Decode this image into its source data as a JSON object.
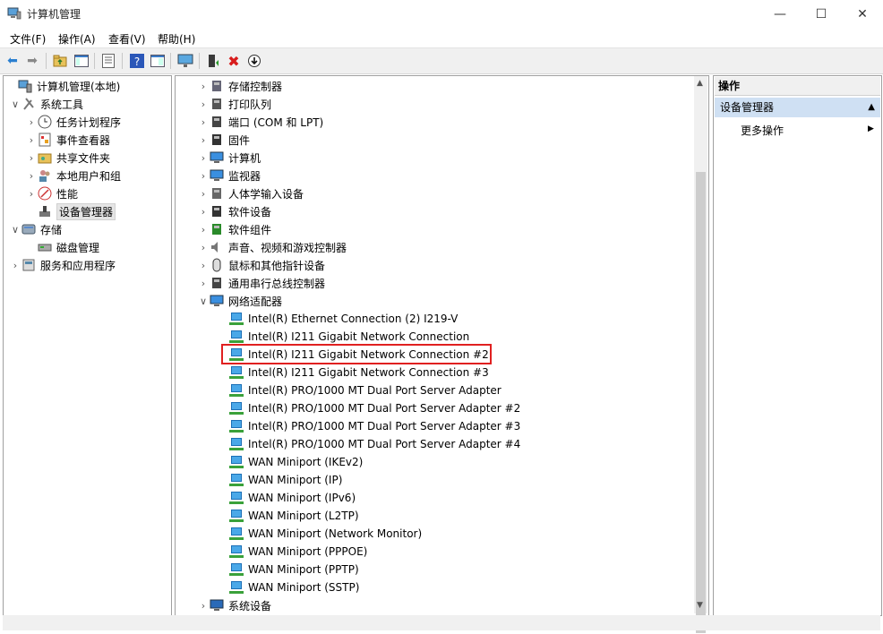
{
  "window": {
    "title": "计算机管理",
    "minimize": "—",
    "maximize": "☐",
    "close": "✕"
  },
  "menu": [
    "文件(F)",
    "操作(A)",
    "查看(V)",
    "帮助(H)"
  ],
  "toolbar_icons": [
    "back-arrow-icon",
    "forward-arrow-icon",
    "folder-up-icon",
    "console-tree-icon",
    "properties-icon",
    "help-icon",
    "view-icon",
    "monitor-icon",
    "update-driver-icon",
    "uninstall-icon",
    "scan-icon"
  ],
  "left_tree": [
    {
      "label": "计算机管理(本地)",
      "level": 0,
      "chev": "",
      "icon": "computer-management-icon"
    },
    {
      "label": "系统工具",
      "level": 1,
      "chev": "∨",
      "icon": "tools-icon"
    },
    {
      "label": "任务计划程序",
      "level": 2,
      "chev": "›",
      "icon": "clock-icon"
    },
    {
      "label": "事件查看器",
      "level": 2,
      "chev": "›",
      "icon": "event-viewer-icon"
    },
    {
      "label": "共享文件夹",
      "level": 2,
      "chev": "›",
      "icon": "shared-folder-icon"
    },
    {
      "label": "本地用户和组",
      "level": 2,
      "chev": "›",
      "icon": "users-icon"
    },
    {
      "label": "性能",
      "level": 2,
      "chev": "›",
      "icon": "performance-icon"
    },
    {
      "label": "设备管理器",
      "level": 2,
      "chev": "",
      "icon": "device-manager-icon",
      "selected": true
    },
    {
      "label": "存储",
      "level": 1,
      "chev": "∨",
      "icon": "storage-icon"
    },
    {
      "label": "磁盘管理",
      "level": 2,
      "chev": "",
      "icon": "disk-icon"
    },
    {
      "label": "服务和应用程序",
      "level": 1,
      "chev": "›",
      "icon": "services-icon"
    }
  ],
  "device_categories_top": [
    {
      "label": "存储控制器",
      "icon": "storage-controller-icon"
    },
    {
      "label": "打印队列",
      "icon": "printer-icon"
    },
    {
      "label": "端口 (COM 和 LPT)",
      "icon": "port-icon"
    },
    {
      "label": "固件",
      "icon": "firmware-icon"
    },
    {
      "label": "计算机",
      "icon": "computer-icon"
    },
    {
      "label": "监视器",
      "icon": "monitor-icon"
    },
    {
      "label": "人体学输入设备",
      "icon": "hid-icon"
    },
    {
      "label": "软件设备",
      "icon": "software-device-icon"
    },
    {
      "label": "软件组件",
      "icon": "software-component-icon"
    },
    {
      "label": "声音、视频和游戏控制器",
      "icon": "sound-icon"
    },
    {
      "label": "鼠标和其他指针设备",
      "icon": "mouse-icon"
    },
    {
      "label": "通用串行总线控制器",
      "icon": "usb-icon"
    }
  ],
  "network_category": {
    "label": "网络适配器",
    "chev": "∨",
    "icon": "network-adapter-icon"
  },
  "network_adapters": [
    "Intel(R) Ethernet Connection (2) I219-V",
    "Intel(R) I211 Gigabit Network Connection",
    "Intel(R) I211 Gigabit Network Connection #2",
    "Intel(R) I211 Gigabit Network Connection #3",
    "Intel(R) PRO/1000 MT Dual Port Server Adapter",
    "Intel(R) PRO/1000 MT Dual Port Server Adapter #2",
    "Intel(R) PRO/1000 MT Dual Port Server Adapter #3",
    "Intel(R) PRO/1000 MT Dual Port Server Adapter #4",
    "WAN Miniport (IKEv2)",
    "WAN Miniport (IP)",
    "WAN Miniport (IPv6)",
    "WAN Miniport (L2TP)",
    "WAN Miniport (Network Monitor)",
    "WAN Miniport (PPPOE)",
    "WAN Miniport (PPTP)",
    "WAN Miniport (SSTP)"
  ],
  "device_categories_bottom": [
    {
      "label": "系统设备",
      "icon": "system-device-icon"
    }
  ],
  "actions": {
    "header": "操作",
    "section": "设备管理器",
    "more": "更多操作",
    "section_arrow": "▲",
    "more_arrow": "▶"
  }
}
